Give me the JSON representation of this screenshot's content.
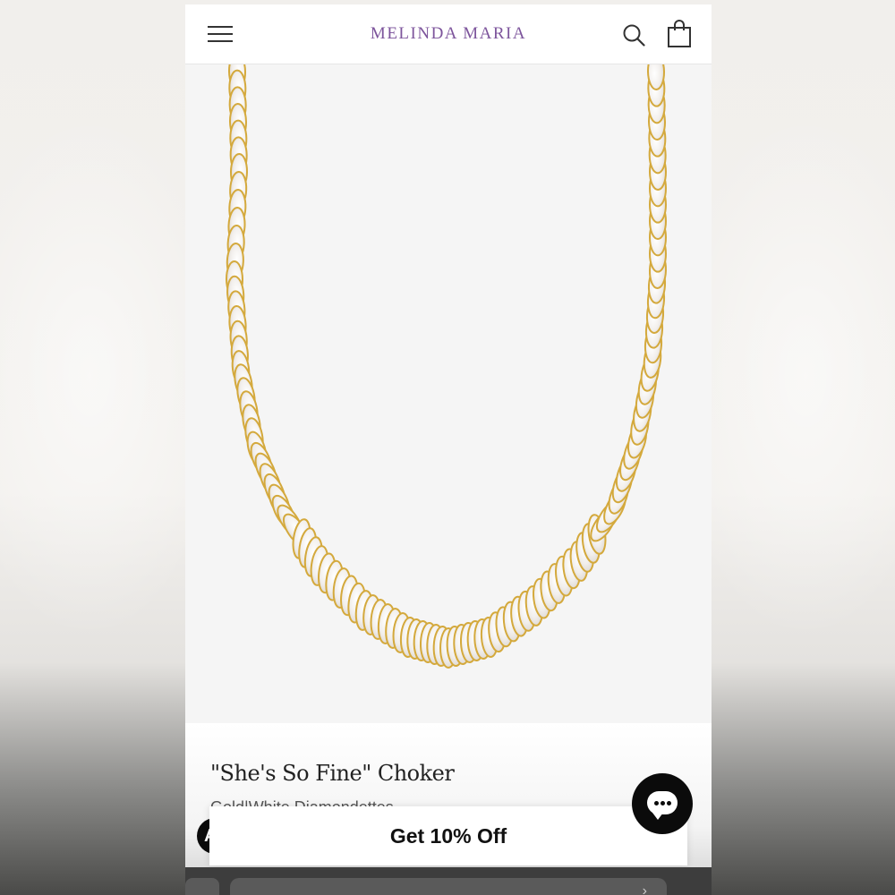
{
  "header": {
    "brand": "MELINDA MARIA",
    "brand_color": "#7d559c",
    "icons": [
      "menu-icon",
      "search-icon",
      "shopping-bag-icon"
    ]
  },
  "product": {
    "title": "\"She's So Fine\" Choker",
    "subtitle": "Gold|White Diamondettes",
    "image_alt": "gold necklace with marquise-cut white stones"
  },
  "chat": {
    "icon": "chat-bubble-icon"
  },
  "promo": {
    "label": "Get 10% Off",
    "badge_letter": "A"
  }
}
